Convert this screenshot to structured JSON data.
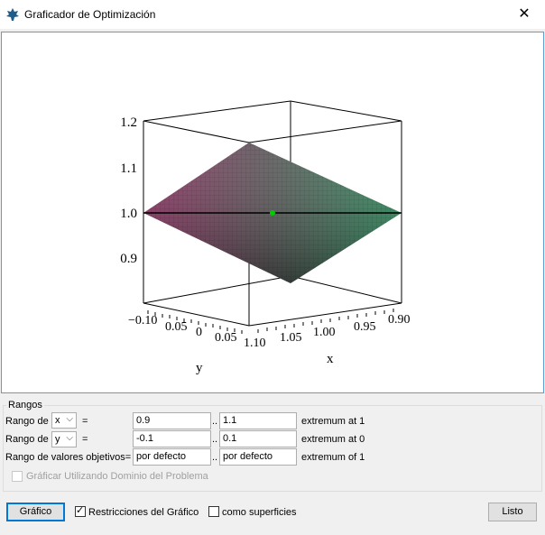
{
  "window": {
    "title": "Graficador de Optimización",
    "close_glyph": "✕",
    "icon": "maple-leaf-icon"
  },
  "plot": {
    "z_ticks": [
      "1.2",
      "1.1",
      "1.0",
      "0.9"
    ],
    "y_ticks": [
      "−0.10",
      "0.05",
      "0",
      "0.05",
      "1.10"
    ],
    "x_ticks": [
      "1.05",
      "1.00",
      "0.95",
      "0.90"
    ],
    "x_label": "x",
    "y_label": "y",
    "surface_colors": {
      "left": "#8b2d5f",
      "right": "#2a8a5a",
      "top": "#5d5d5d",
      "bottom": "#3a3a3a"
    },
    "point_color": "#00cc00"
  },
  "rangos": {
    "legend": "Rangos",
    "row1": {
      "label": "Rango de",
      "var": "x",
      "eq": "=",
      "from": "0.9",
      "sep": "..",
      "to": "1.1",
      "note": "extremum at 1"
    },
    "row2": {
      "label": "Rango de",
      "var": "y",
      "eq": "=",
      "from": "-0.1",
      "sep": "..",
      "to": "0.1",
      "note": "extremum at 0"
    },
    "row3": {
      "label": "Rango de valores objetivos=",
      "from": "por defecto",
      "sep": "..",
      "to": "por defecto",
      "note": "extremum of 1"
    },
    "domain_checkbox": {
      "label": "Gráficar Utilizando Dominio del Problema",
      "checked": false
    }
  },
  "bottom": {
    "plot_button": "Gráfico",
    "restrictions": {
      "label": "Restricciones del Gráfico",
      "checked": true
    },
    "surfaces": {
      "label": "como superficies",
      "checked": false
    },
    "done_button": "Listo"
  }
}
